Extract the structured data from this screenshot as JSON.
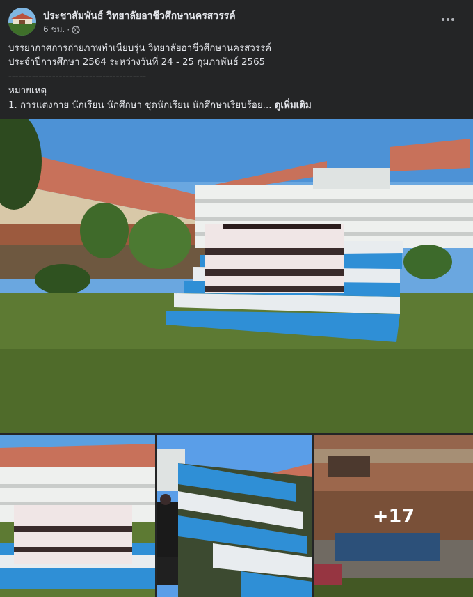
{
  "post": {
    "page_name": "ประชาสัมพันธ์ วิทยาลัยอาชีวศึกษานครสวรรค์",
    "time": "6 ชม.",
    "separator": "·",
    "audience_icon": "globe-icon",
    "more_icon": "more-options-icon",
    "text_lines": [
      "บรรยากาศการถ่ายภาพทำเนียบรุ่น วิทยาลัยอาชีวศึกษานครสวรรค์",
      "ประจำปีการศึกษา 2564 ระหว่างวันที่ 24 - 25 กุมภาพันธ์ 2565",
      "-----------------------------------------",
      "หมายเหตุ",
      "1. การแต่งกาย นักเรียน นักศึกษา ชุดนักเรียน นักศึกษาเรียบร้อย..."
    ],
    "see_more": "ดูเพิ่มเติม"
  },
  "photos": {
    "more_count": "+17"
  },
  "colors": {
    "background": "#242526",
    "text_primary": "#e4e6eb",
    "text_secondary": "#b0b3b8",
    "roof": "#c8715a",
    "sky": "#6aa7e0",
    "grass": "#5d7a33",
    "bleacher_blue": "#2f8fd6"
  }
}
